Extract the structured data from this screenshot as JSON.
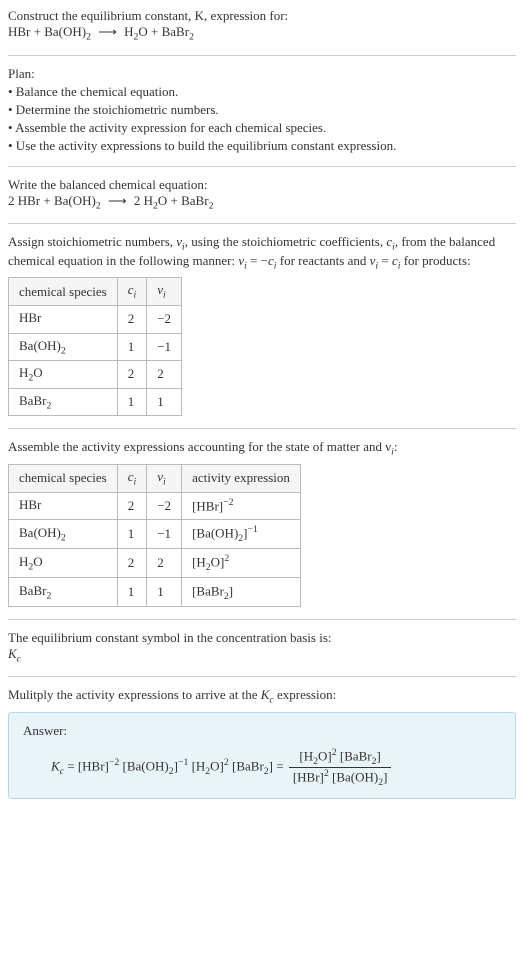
{
  "prompt": {
    "line1": "Construct the equilibrium constant, K, expression for:",
    "eq_lhs1": "HBr + Ba(OH)",
    "eq_lhs1_sub": "2",
    "arrow": "⟶",
    "eq_rhs1a": "H",
    "eq_rhs1a_sub": "2",
    "eq_rhs1b": "O + BaBr",
    "eq_rhs1b_sub": "2"
  },
  "plan": {
    "heading": "Plan:",
    "item1": "• Balance the chemical equation.",
    "item2": "• Determine the stoichiometric numbers.",
    "item3": "• Assemble the activity expression for each chemical species.",
    "item4": "• Use the activity expressions to build the equilibrium constant expression."
  },
  "balanced": {
    "heading": "Write the balanced chemical equation:",
    "lhs_a": "2 HBr + Ba(OH)",
    "lhs_a_sub": "2",
    "arrow": "⟶",
    "rhs_a": "2 H",
    "rhs_a_sub": "2",
    "rhs_b": "O + BaBr",
    "rhs_b_sub": "2"
  },
  "stoich": {
    "text1": "Assign stoichiometric numbers, ",
    "nu": "ν",
    "sub_i": "i",
    "text2": ", using the stoichiometric coefficients, ",
    "c": "c",
    "text3": ", from the balanced chemical equation in the following manner: ",
    "nu_eq_neg": " = −",
    "text4": " for reactants and ",
    "nu_eq": " = ",
    "text5": " for products:",
    "table": {
      "h1": "chemical species",
      "h2": "c",
      "h2_sub": "i",
      "h3": "ν",
      "h3_sub": "i",
      "rows": [
        {
          "sp_a": "HBr",
          "sp_b": "",
          "sp_sub": "",
          "c": "2",
          "nu": "−2"
        },
        {
          "sp_a": "Ba(OH)",
          "sp_b": "",
          "sp_sub": "2",
          "c": "1",
          "nu": "−1"
        },
        {
          "sp_a": "H",
          "sp_b": "O",
          "sp_sub": "2",
          "c": "2",
          "nu": "2"
        },
        {
          "sp_a": "BaBr",
          "sp_b": "",
          "sp_sub": "2",
          "c": "1",
          "nu": "1"
        }
      ]
    }
  },
  "activity": {
    "heading": "Assemble the activity expressions accounting for the state of matter and ν",
    "heading_sub": "i",
    "heading_end": ":",
    "table": {
      "h1": "chemical species",
      "h2": "c",
      "h2_sub": "i",
      "h3": "ν",
      "h3_sub": "i",
      "h4": "activity expression",
      "rows": [
        {
          "sp_a": "HBr",
          "sp_b": "",
          "sp_sub": "",
          "c": "2",
          "nu": "−2",
          "act": "[HBr]",
          "act_sup": "−2"
        },
        {
          "sp_a": "Ba(OH)",
          "sp_b": "",
          "sp_sub": "2",
          "c": "1",
          "nu": "−1",
          "act": "[Ba(OH)",
          "act_sub": "2",
          "act_end": "]",
          "act_sup": "−1"
        },
        {
          "sp_a": "H",
          "sp_b": "O",
          "sp_sub": "2",
          "c": "2",
          "nu": "2",
          "act": "[H",
          "act_sub": "2",
          "act_end": "O]",
          "act_sup": "2"
        },
        {
          "sp_a": "BaBr",
          "sp_b": "",
          "sp_sub": "2",
          "c": "1",
          "nu": "1",
          "act": "[BaBr",
          "act_sub": "2",
          "act_end": "]",
          "act_sup": ""
        }
      ]
    }
  },
  "symbol": {
    "line1": "The equilibrium constant symbol in the concentration basis is:",
    "K": "K",
    "K_sub": "c"
  },
  "multiply": {
    "heading_a": "Mulitply the activity expressions to arrive at the ",
    "K": "K",
    "K_sub": "c",
    "heading_b": " expression:"
  },
  "answer": {
    "label": "Answer:",
    "K": "K",
    "K_sub": "c",
    "eq": " = [HBr]",
    "sup1": "−2",
    "t2": " [Ba(OH)",
    "sub2": "2",
    "t2b": "]",
    "sup2": "−1",
    "t3": " [H",
    "sub3": "2",
    "t3b": "O]",
    "sup3": "2",
    "t4": " [BaBr",
    "sub4": "2",
    "t4b": "] = ",
    "num_a": "[H",
    "num_a_sub": "2",
    "num_b": "O]",
    "num_b_sup": "2",
    "num_c": " [BaBr",
    "num_c_sub": "2",
    "num_d": "]",
    "den_a": "[HBr]",
    "den_a_sup": "2",
    "den_b": " [Ba(OH)",
    "den_b_sub": "2",
    "den_c": "]"
  }
}
